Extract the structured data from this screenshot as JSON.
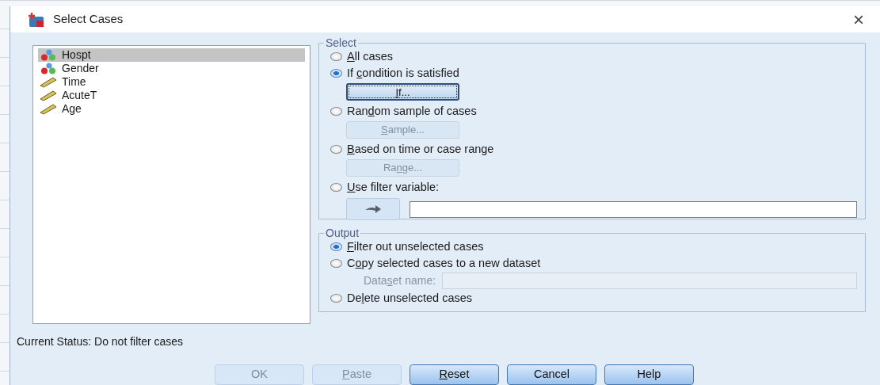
{
  "window": {
    "title": "Select Cases",
    "close": "×"
  },
  "variables": [
    {
      "name": "Hospt",
      "kind": "nominal",
      "selected": true
    },
    {
      "name": "Gender",
      "kind": "nominal",
      "selected": false
    },
    {
      "name": "Time",
      "kind": "scale",
      "selected": false
    },
    {
      "name": "AcuteT",
      "kind": "scale",
      "selected": false
    },
    {
      "name": "Age",
      "kind": "scale",
      "selected": false
    }
  ],
  "select": {
    "title": "Select",
    "options": [
      {
        "kind": "plain",
        "label": {
          "key": "A",
          "post": "ll cases"
        },
        "selected": false
      },
      {
        "kind": "with_button",
        "label": {
          "pre": "If ",
          "key": "c",
          "post": "ondition is satisfied"
        },
        "selected": true,
        "button": {
          "label": {
            "key": "I",
            "post": "f..."
          },
          "disabled": false,
          "focused": true
        }
      },
      {
        "kind": "with_button",
        "label": {
          "pre": "Ran",
          "key": "d",
          "post": "om sample of cases"
        },
        "selected": false,
        "button": {
          "label": {
            "key": "S",
            "post": "ample..."
          },
          "disabled": true,
          "focused": false
        }
      },
      {
        "kind": "with_button",
        "label": {
          "key": "B",
          "post": "ased on time or case range"
        },
        "selected": false,
        "button": {
          "label": {
            "pre": "Ra",
            "key": "n",
            "post": "ge..."
          },
          "disabled": true,
          "focused": false
        }
      },
      {
        "kind": "with_filter",
        "label": {
          "key": "U",
          "post": "se filter variable:"
        },
        "selected": false
      }
    ]
  },
  "output": {
    "title": "Output",
    "options": [
      {
        "kind": "plain",
        "label": {
          "key": "F",
          "post": "ilter out unselected cases"
        },
        "selected": true
      },
      {
        "kind": "with_name",
        "label": {
          "pre": "C",
          "key": "o",
          "post": "py selected cases to a new dataset"
        },
        "selected": false,
        "field_label": {
          "pre": "Data",
          "key": "s",
          "post": "et name:"
        }
      },
      {
        "kind": "plain",
        "label": {
          "pre": "De",
          "key": "l",
          "post": "ete unselected cases"
        },
        "selected": false
      }
    ]
  },
  "status": "Current Status: Do not filter cases",
  "buttons": [
    {
      "label": {
        "post": "OK"
      },
      "disabled": true
    },
    {
      "label": {
        "key": "P",
        "post": "aste"
      },
      "disabled": true
    },
    {
      "label": {
        "key": "R",
        "post": "eset"
      },
      "disabled": false
    },
    {
      "label": {
        "post": "Cancel"
      },
      "disabled": false
    },
    {
      "label": {
        "post": "Help"
      },
      "disabled": false
    }
  ]
}
